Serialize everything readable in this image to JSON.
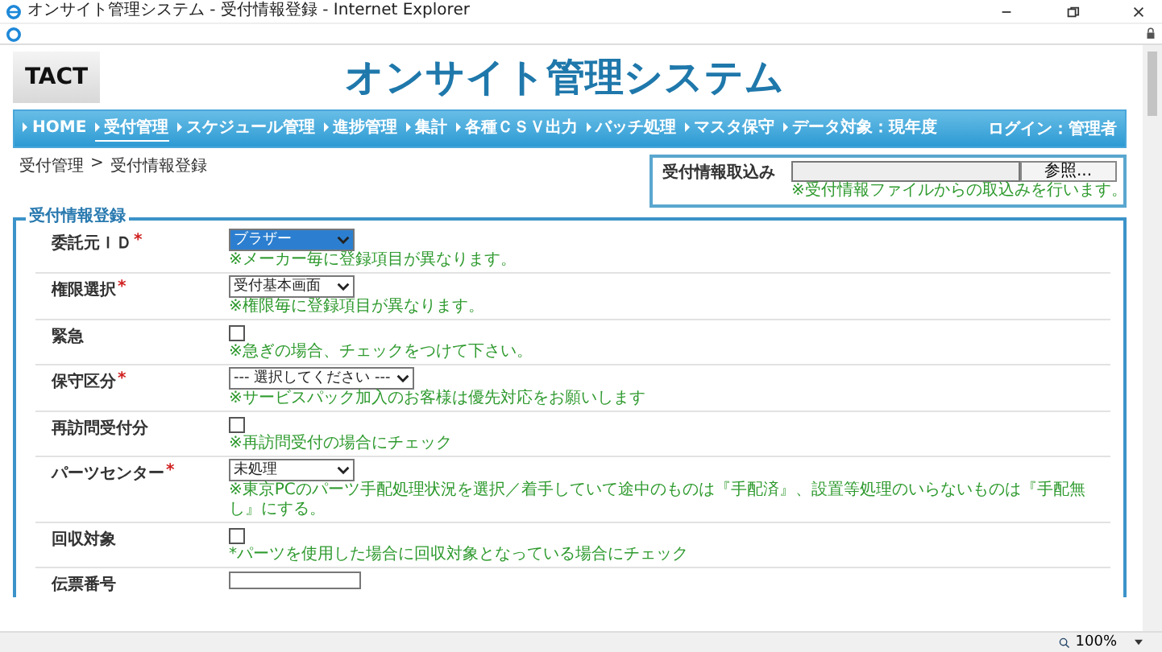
{
  "window": {
    "title": "オンサイト管理システム - 受付情報登録 - Internet Explorer"
  },
  "header": {
    "logo": "TACT",
    "title": "オンサイト管理システム"
  },
  "nav": {
    "items": [
      {
        "label": "HOME",
        "selected": false
      },
      {
        "label": "受付管理",
        "selected": true
      },
      {
        "label": "スケジュール管理",
        "selected": false
      },
      {
        "label": "進捗管理",
        "selected": false
      },
      {
        "label": "集計",
        "selected": false
      },
      {
        "label": "各種ＣＳＶ出力",
        "selected": false
      },
      {
        "label": "バッチ処理",
        "selected": false
      },
      {
        "label": "マスタ保守",
        "selected": false
      },
      {
        "label": "データ対象：現年度",
        "selected": false
      }
    ],
    "login": "ログイン：管理者"
  },
  "breadcrumb": [
    "受付管理",
    "受付情報登録"
  ],
  "breadcrumb_separator": ">",
  "import": {
    "label": "受付情報取込み",
    "button": "参照...",
    "hint": "※受付情報ファイルからの取込みを行います。"
  },
  "form": {
    "legend": "受付情報登録",
    "fields": [
      {
        "label": "委託元ＩＤ",
        "required_mark": "*",
        "kind": "select",
        "value": "ブラザー",
        "focused": true,
        "hint": "※メーカー毎に登録項目が異なります。"
      },
      {
        "label": "権限選択",
        "required_mark": "*",
        "kind": "select",
        "value": "受付基本画面",
        "focused": false,
        "hint": "※権限毎に登録項目が異なります。"
      },
      {
        "label": "緊急",
        "kind": "checkbox",
        "checked": false,
        "hint": "※急ぎの場合、チェックをつけて下さい。"
      },
      {
        "label": "保守区分",
        "required_mark": "*",
        "kind": "select",
        "value": "--- 選択してください ---",
        "focused": false,
        "hint": "※サービスパック加入のお客様は優先対応をお願いします"
      },
      {
        "label": "再訪問受付分",
        "kind": "checkbox",
        "checked": false,
        "hint": "※再訪問受付の場合にチェック"
      },
      {
        "label": "パーツセンター",
        "required_mark": "*",
        "kind": "select",
        "value": "未処理",
        "focused": false,
        "hint": "※東京PCのパーツ手配処理状況を選択／着手していて途中のものは『手配済』、設置等処理のいらないものは『手配無し』にする。"
      },
      {
        "label": "回収対象",
        "kind": "checkbox",
        "checked": false,
        "hint": "*パーツを使用した場合に回収対象となっている場合にチェック"
      },
      {
        "label": "伝票番号",
        "kind": "text"
      }
    ]
  },
  "status_bar": {
    "zoom": "100%"
  }
}
